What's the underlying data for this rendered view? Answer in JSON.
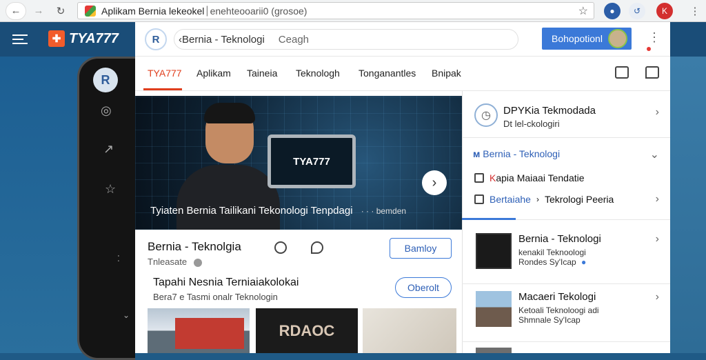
{
  "browser": {
    "tab_title": "Aplikam Bernia lekeokel",
    "url": "enehteooarii0 (grosoe)"
  },
  "site": {
    "brand": "TYA777"
  },
  "panel": {
    "logo": "R",
    "search_value": "‹Bernia - Teknologi",
    "search_placeholder": "Ceagh",
    "action_button": "Bohopotionl",
    "tabs": [
      "TYA777",
      "Aplikam",
      "Taineia",
      "Teknologh",
      "Tonganantles",
      "Bnipak"
    ]
  },
  "hero": {
    "tablet_text": "TYA777",
    "caption": "Tyiaten Bernia Tailikani Tekonologi Tenpdagi",
    "caption_right": "· · · bemden"
  },
  "article": {
    "title": "Bernia - Teknolgia",
    "meta": "Tnleasate",
    "button": "Bamloy"
  },
  "subarticle": {
    "title": "Tapahi Nesnia Terniaiakolokai",
    "meta": "Bera7 e Tasmi onalr Teknologin",
    "button": "Oberolt",
    "thumb2_text": "RDAOC"
  },
  "sidebar": {
    "top_title": "DPYKia Tekmodada",
    "top_sub": "Dt lel-ckologiri",
    "section_title": "Bernia - Teknologi",
    "row1_prefix": "K",
    "row1_rest": "apia Maiaai Tendatie",
    "row2_hi": "Bertaiahe",
    "row2_rest": "Tekrologi Peeria",
    "cards": [
      {
        "title": "Bernia - Teknologi",
        "desc": "kenakil Teknoologi",
        "meta": "Rondes Sy'Icap"
      },
      {
        "title": "Macaeri Tekologi",
        "desc": "Ketoali Teknoloogi adi",
        "meta": "Shmnale Sy'Icap"
      }
    ]
  },
  "colors": {
    "accent": "#3b79d8",
    "brand_red": "#e03e1d"
  }
}
